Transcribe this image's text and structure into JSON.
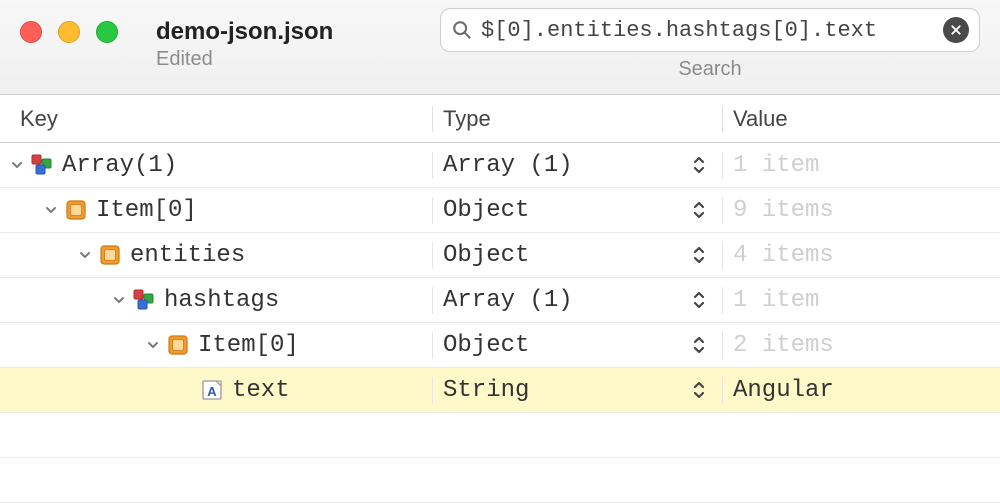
{
  "window": {
    "title": "demo-json.json",
    "subtitle": "Edited"
  },
  "search": {
    "value": "$[0].entities.hashtags[0].text",
    "label": "Search"
  },
  "columns": {
    "key": "Key",
    "type": "Type",
    "value": "Value"
  },
  "rows": [
    {
      "indent": 0,
      "expanded": true,
      "icon": "array",
      "key": "Array(1)",
      "type": "Array (1)",
      "value": "1 item",
      "muted": true,
      "selected": false
    },
    {
      "indent": 1,
      "expanded": true,
      "icon": "object",
      "key": "Item[0]",
      "type": "Object",
      "value": "9 items",
      "muted": true,
      "selected": false
    },
    {
      "indent": 2,
      "expanded": true,
      "icon": "object",
      "key": "entities",
      "type": "Object",
      "value": "4 items",
      "muted": true,
      "selected": false
    },
    {
      "indent": 3,
      "expanded": true,
      "icon": "array",
      "key": "hashtags",
      "type": "Array (1)",
      "value": "1 item",
      "muted": true,
      "selected": false
    },
    {
      "indent": 4,
      "expanded": true,
      "icon": "object",
      "key": "Item[0]",
      "type": "Object",
      "value": "2 items",
      "muted": true,
      "selected": false
    },
    {
      "indent": 5,
      "expanded": null,
      "icon": "string",
      "key": "text",
      "type": "String",
      "value": "Angular",
      "muted": false,
      "selected": true
    }
  ]
}
